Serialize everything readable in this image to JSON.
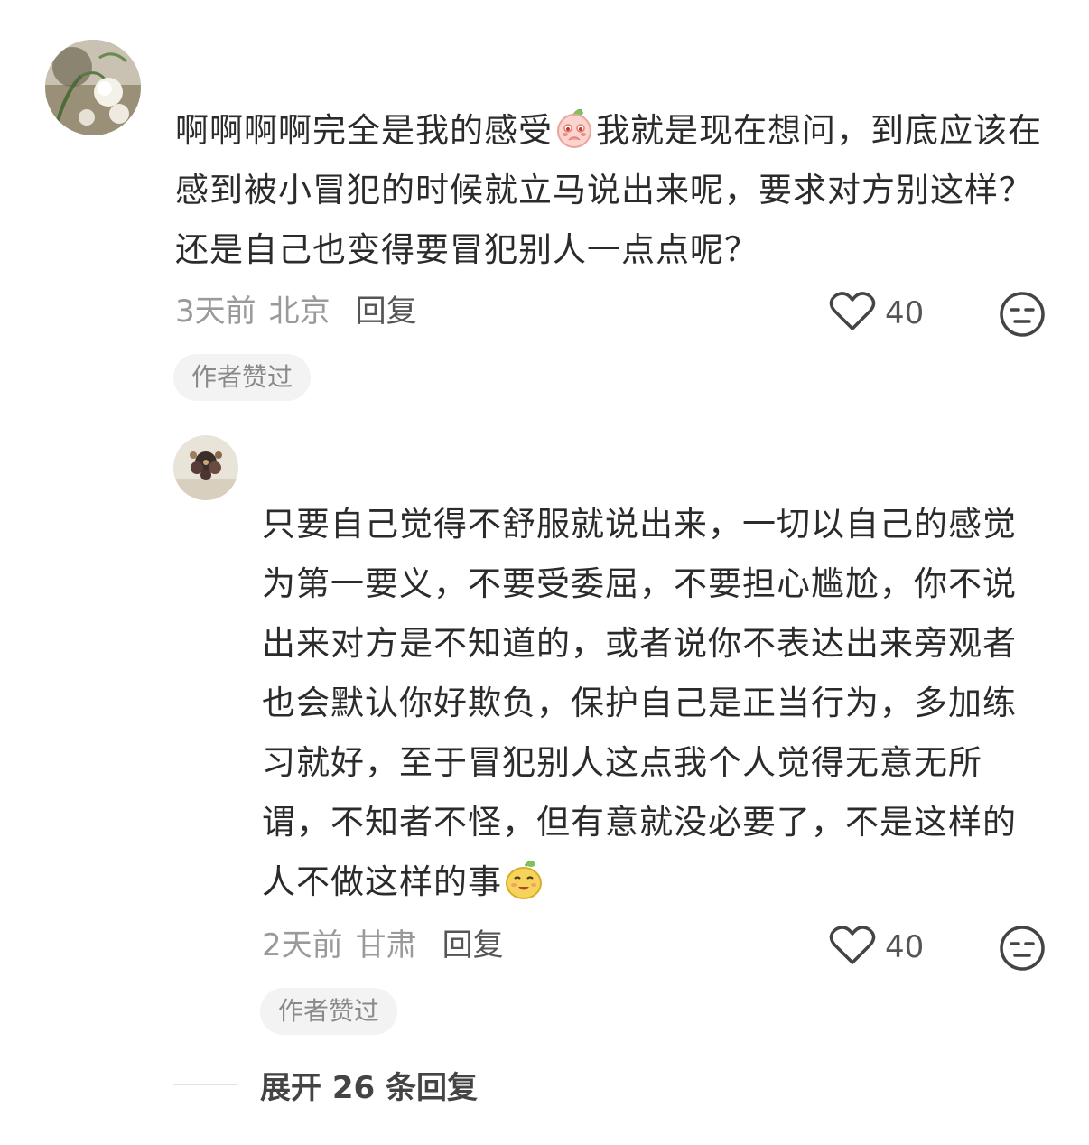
{
  "comment": {
    "text_line1_a": "啊啊啊啊完全是我的感受",
    "text_line1_emoji": "blushing-peach-emoji",
    "text_line1_b": "我就是现在想问，到底应该在感到被小冒犯的时候就立马说出来呢，要求对方别这样？还是自己也变得要冒犯别人一点点呢？",
    "time": "3天前",
    "location": "北京",
    "reply_label": "回复",
    "like_icon": "heart-outline-icon",
    "like_count": "40",
    "dislike_icon": "unamused-face-icon",
    "badge": "作者赞过"
  },
  "reply": {
    "text_a": "只要自己觉得不舒服就说出来，一切以自己的感觉为第一要义，不要受委屈，不要担心尴尬，你不说出来对方是不知道的，或者说你不表达出来旁观者也会默认你好欺负，保护自己是正当行为，多加练习就好，至于冒犯别人这点我个人觉得无意无所谓，不知者不怪，但有意就没必要了，不是这样的人不做这样的事",
    "text_emoji": "smiling-pear-emoji",
    "time": "2天前",
    "location": "甘肃",
    "reply_label": "回复",
    "like_icon": "heart-outline-icon",
    "like_count": "40",
    "dislike_icon": "unamused-face-icon",
    "badge": "作者赞过"
  },
  "expand": {
    "label": "展开 26 条回复"
  },
  "colors": {
    "text": "#2b2b2b",
    "meta": "#9a9a9a",
    "badge_bg": "#f3f3f3"
  }
}
